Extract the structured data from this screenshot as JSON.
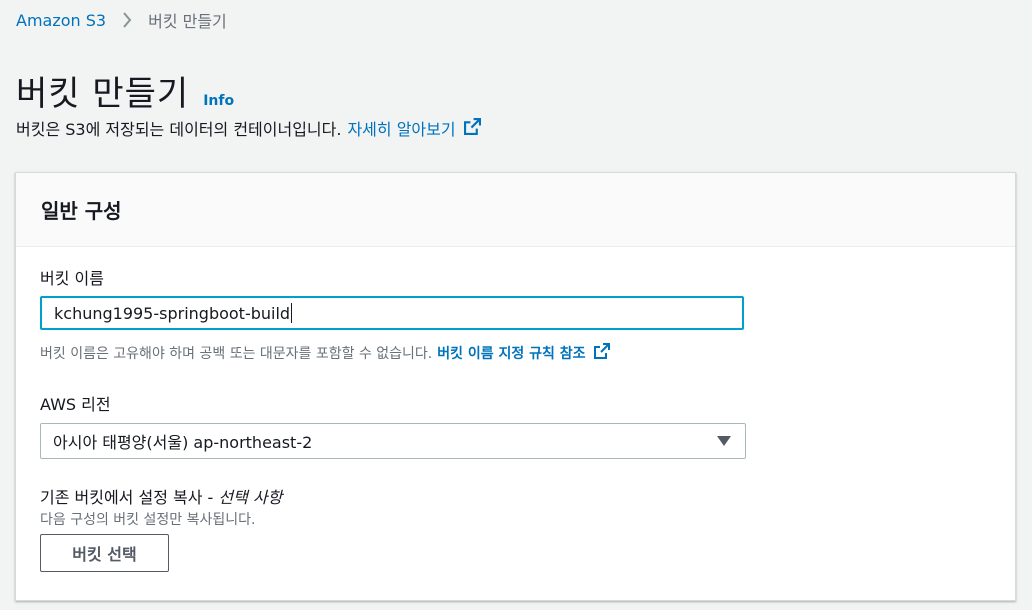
{
  "breadcrumb": {
    "root": "Amazon S3",
    "current": "버킷 만들기"
  },
  "page": {
    "title": "버킷 만들기",
    "info_link": "Info",
    "description": "버킷은 S3에 저장되는 데이터의 컨테이너입니다.",
    "learn_more": "자세히 알아보기"
  },
  "general_config": {
    "header": "일반 구성",
    "bucket_name": {
      "label": "버킷 이름",
      "value": "kchung1995-springboot-build",
      "hint": "버킷 이름은 고유해야 하며 공백 또는 대문자를 포함할 수 없습니다.",
      "rules_link": "버킷 이름 지정 규칙 참조"
    },
    "region": {
      "label": "AWS 리전",
      "selected": "아시아 태평양(서울) ap-northeast-2"
    },
    "copy_settings": {
      "label": "기존 버킷에서 설정 복사 - ",
      "optional": "선택 사항",
      "description": "다음 구성의 버킷 설정만 복사됩니다.",
      "button": "버킷 선택"
    }
  },
  "colors": {
    "link": "#0073bb",
    "focus_border": "#00a1c9",
    "background": "#f2f3f3"
  }
}
